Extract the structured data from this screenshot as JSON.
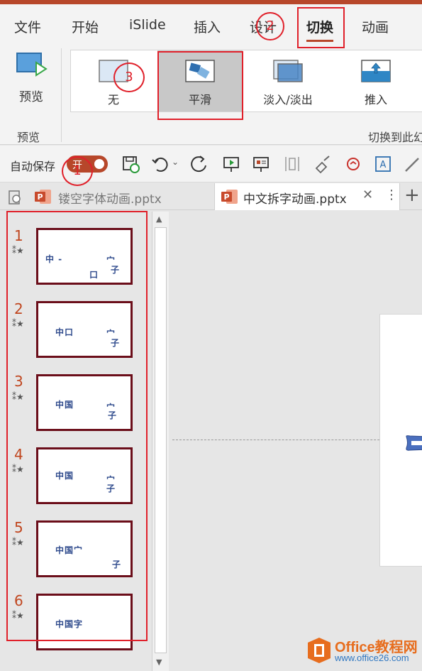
{
  "ribbon_tabs": [
    "文件",
    "开始",
    "iSlide",
    "插入",
    "设计",
    "切换",
    "动画"
  ],
  "ribbon": {
    "preview_label": "预览",
    "preview_group_label": "预览",
    "transitions_group_label": "切换到此幻",
    "transitions": [
      "无",
      "平滑",
      "淡入/淡出",
      "推入"
    ]
  },
  "qat": {
    "autosave_label": "自动保存",
    "toggle_label": "开"
  },
  "doc_tabs": {
    "inactive_name": "镂空字体动画.pptx",
    "active_name": "中文拆字动画.pptx",
    "close_glyph": "✕",
    "more_glyph": "⋮",
    "add_glyph": "+"
  },
  "slides": [
    {
      "num": "1",
      "star": "⁑★"
    },
    {
      "num": "2",
      "star": "⁑★"
    },
    {
      "num": "3",
      "star": "⁑★"
    },
    {
      "num": "4",
      "star": "⁑★"
    },
    {
      "num": "5",
      "star": "⁑★"
    },
    {
      "num": "6",
      "star": "⁑★"
    }
  ],
  "thumb_texts": {
    "s1a": "中 -",
    "s1b": "宀",
    "s1c": "子",
    "s1d": "口",
    "s2a": "中口",
    "s2b": "宀",
    "s2c": "子",
    "s3a": "中国",
    "s3b": "宀",
    "s3c": "子",
    "s4a": "中国",
    "s4b": "宀",
    "s4c": "子",
    "s5a": "中国宀",
    "s5b": "子",
    "s6a": "中国字"
  },
  "annotations": {
    "c1": "1",
    "c2": "2",
    "c3": "3"
  },
  "watermark": {
    "name": "Office教程网",
    "url": "www.office26.com"
  },
  "colors": {
    "accent": "#b7472a",
    "annotation": "#e0202a",
    "thumb_border": "#6b0e1a",
    "slide_text": "#2e4a8c"
  }
}
